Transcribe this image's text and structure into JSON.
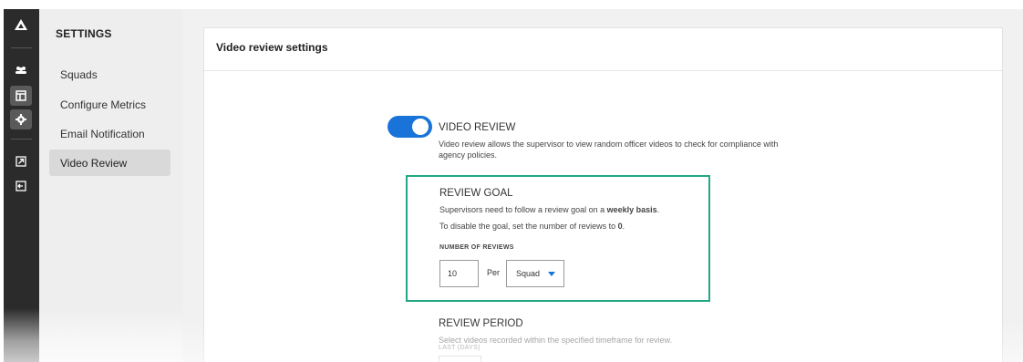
{
  "sidebar": {
    "icons": [
      "logo-icon",
      "users-icon",
      "layout-icon",
      "gear-icon",
      "external-link-icon",
      "logout-icon"
    ]
  },
  "settings_nav": {
    "title": "SETTINGS",
    "items": [
      {
        "label": "Squads"
      },
      {
        "label": "Configure Metrics"
      },
      {
        "label": "Email Notification"
      },
      {
        "label": "Video Review"
      }
    ],
    "active_index": 3
  },
  "card": {
    "title": "Video review settings"
  },
  "video_review": {
    "toggle_on": true,
    "title": "VIDEO REVIEW",
    "description_line1": "Video review allows the supervisor to view random officer videos to check for compliance with",
    "description_line2": "agency policies."
  },
  "review_goal": {
    "title": "REVIEW GOAL",
    "line1_prefix": "Supervisors need to follow a review goal on a ",
    "line1_bold": "weekly basis",
    "line1_suffix": ".",
    "line2_prefix": "To disable the goal, set the number of reviews to ",
    "line2_bold": "0",
    "line2_suffix": ".",
    "number_label": "NUMBER OF REVIEWS",
    "number_value": "10",
    "per_label": "Per",
    "per_selected": "Squad"
  },
  "review_period": {
    "title": "REVIEW PERIOD",
    "description": "Select videos recorded within the specified timeframe for review.",
    "last_days_label": "LAST (DAYS)"
  },
  "colors": {
    "accent": "#1a73d9",
    "highlight_box": "#22a884",
    "rail": "#2b2b2b"
  }
}
